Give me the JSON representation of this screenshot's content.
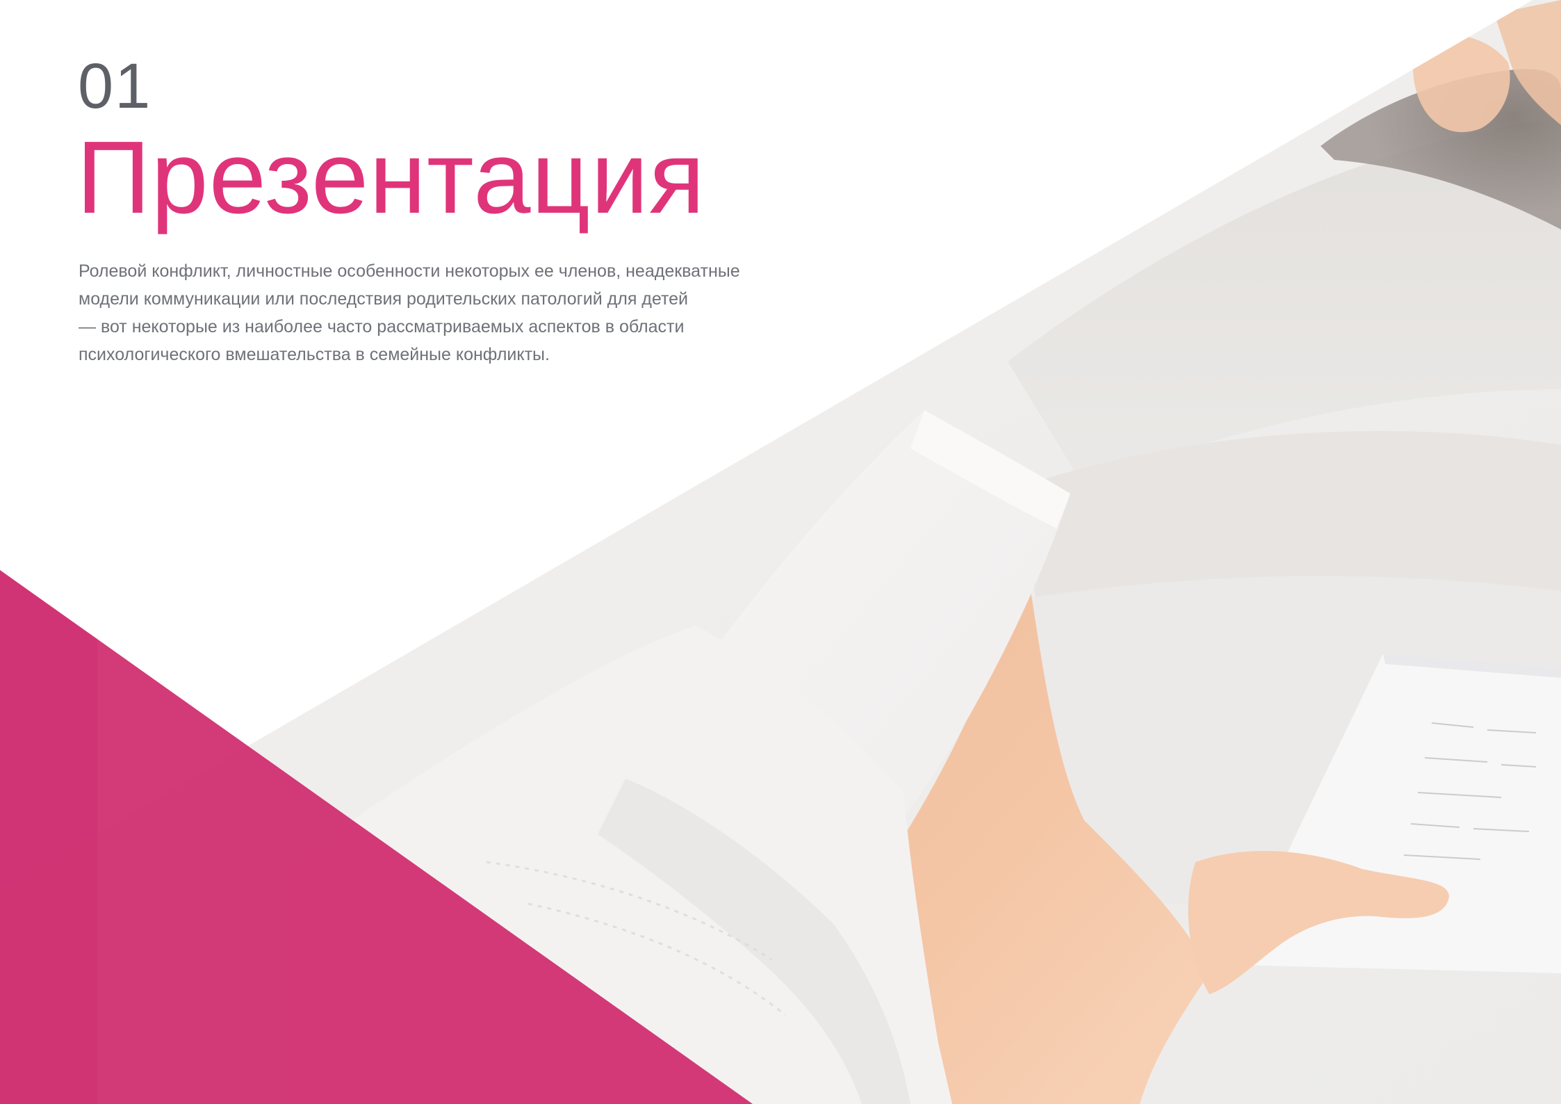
{
  "section": {
    "number": "01",
    "title": "Презентация"
  },
  "intro": {
    "lines": [
      "Ролевой конфликт, личностные особенности некоторых ее членов, неадекватные",
      "модели коммуникации или последствия родительских патологий для детей",
      "— вот некоторые из наиболее часто рассматриваемых аспектов в области",
      "психологического вмешательства в семейные конфликты."
    ]
  },
  "colors": {
    "accent": "#e0347a",
    "accent_triangle": "#d02b6e",
    "number": "#5d6066",
    "body_text": "#6e7177"
  },
  "images": {
    "photo": "woman-lying-on-bed-holding-notes"
  }
}
